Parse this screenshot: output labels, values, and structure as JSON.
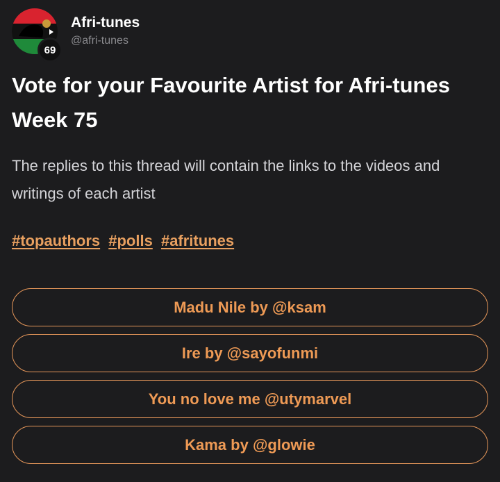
{
  "author": {
    "name": "Afri-tunes",
    "handle": "@afri-tunes",
    "level": "69",
    "avatar_colors": [
      "#d9232f",
      "#000000",
      "#1f8a3a"
    ]
  },
  "post": {
    "title": "Vote for your Favourite Artist for Afri-tunes Week 75",
    "body": "The replies to this thread will contain the links to the videos and writings of each artist",
    "tags": [
      "#topauthors",
      "#polls",
      "#afritunes"
    ]
  },
  "poll": {
    "options": [
      "Madu Nile by @ksam",
      "Ire by @sayofunmi",
      "You no love me @utymarvel",
      "Kama by @glowie"
    ]
  },
  "colors": {
    "background": "#1c1c1e",
    "accent": "#e8985a",
    "muted": "#8a8a8e"
  }
}
